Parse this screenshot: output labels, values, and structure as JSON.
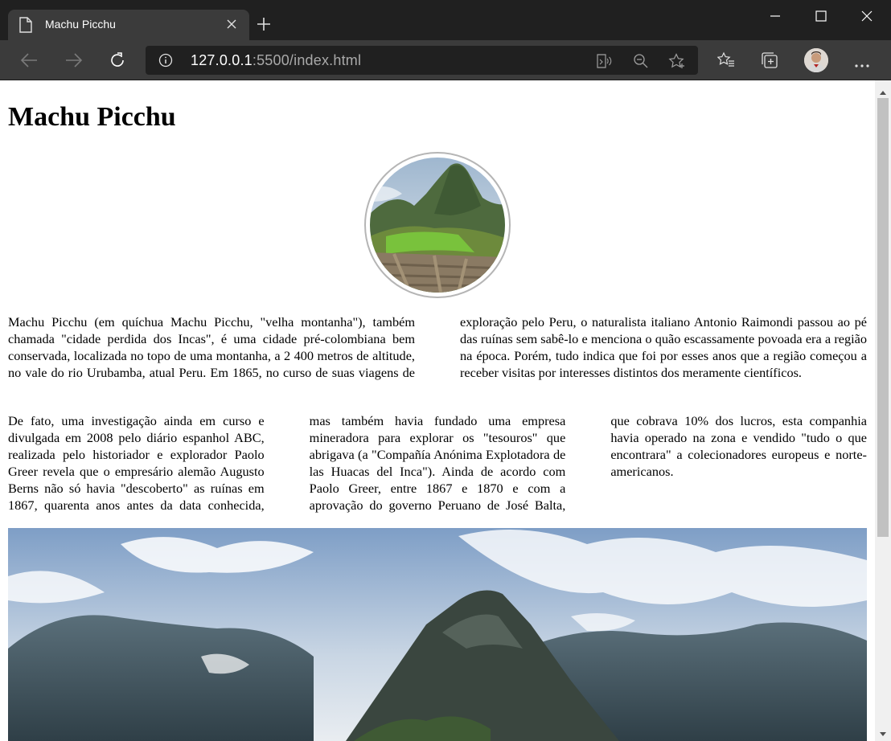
{
  "browser": {
    "tab_title": "Machu Picchu",
    "url_host": "127.0.0.1",
    "url_rest": ":5500/index.html"
  },
  "page": {
    "heading": "Machu Picchu",
    "paragraph1": "Machu Picchu (em quíchua Machu Picchu, \"velha montanha\"), também chamada \"cidade perdida dos Incas\", é uma cidade pré-colombiana bem conservada, localizada no topo de uma montanha, a 2 400 metros de altitude, no vale do rio Urubamba, atual Peru. Em 1865, no curso de suas viagens de exploração pelo Peru, o naturalista italiano Antonio Raimondi passou ao pé das ruínas sem sabê-lo e menciona o quão escassamente povoada era a região na época. Porém, tudo indica que foi por esses anos que a região começou a receber visitas por interesses distintos dos meramente científicos.",
    "paragraph2": "De fato, uma investigação ainda em curso e divulgada em 2008 pelo diário espanhol ABC, realizada pelo historiador e explorador Paolo Greer revela que o empresário alemão Augusto Berns não só havia \"descoberto\" as ruínas em 1867, quarenta anos antes da data conhecida, mas também havia fundado uma empresa mineradora para explorar os \"tesouros\" que abrigava (a \"Compañía Anónima Explotadora de las Huacas del Inca\"). Ainda de acordo com Paolo Greer, entre 1867 e 1870 e com a aprovação do governo Peruano de José Balta, que cobrava 10% dos lucros, esta companhia havia operado na zona e vendido \"tudo o que encontrara\" a colecionadores europeus e norte-americanos."
  },
  "colors": {
    "chrome_dark": "#202020",
    "chrome_tab": "#3b3b3b",
    "page_bg": "#ffffff"
  }
}
